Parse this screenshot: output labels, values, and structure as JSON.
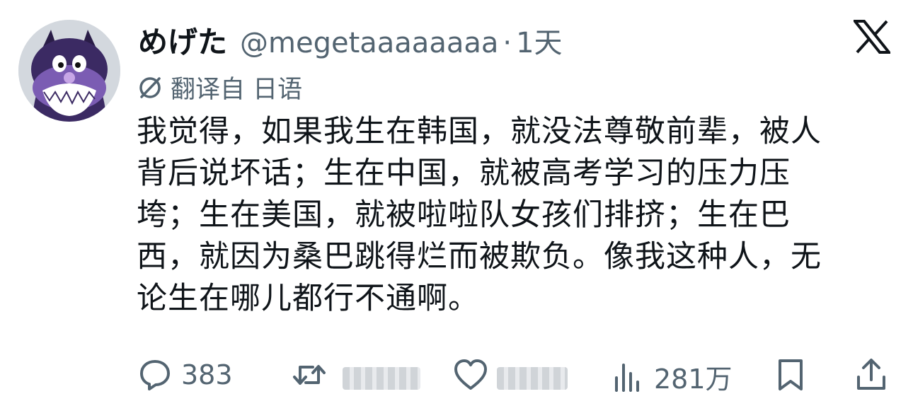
{
  "author": {
    "display_name": "めげた",
    "handle": "@megetaaaaaaaa",
    "separator": "·",
    "time": "1天"
  },
  "translation": {
    "icon": "translate-icon",
    "label": "翻译自 日语"
  },
  "tweet": {
    "lines": [
      "我觉得，如果我生在韩国，就没法尊敬前辈，被人",
      "背后说坏话；生在中国，就被高考学习的压力压",
      "垮；生在美国，就被啦啦队女孩们排挤；生在巴",
      "西，就因为桑巴跳得烂而被欺负。像我这种人，无",
      "论生在哪儿都行不通啊。"
    ]
  },
  "actions": {
    "reply": {
      "icon": "reply-icon",
      "count": "383"
    },
    "retweet": {
      "icon": "retweet-icon",
      "count": ""
    },
    "like": {
      "icon": "like-icon",
      "count": ""
    },
    "views": {
      "icon": "views-icon",
      "count": "281万"
    },
    "bookmark": {
      "icon": "bookmark-icon"
    },
    "share": {
      "icon": "share-icon"
    }
  },
  "brand": {
    "logo": "x-logo",
    "accent": "#0f1419",
    "muted": "#536471"
  }
}
